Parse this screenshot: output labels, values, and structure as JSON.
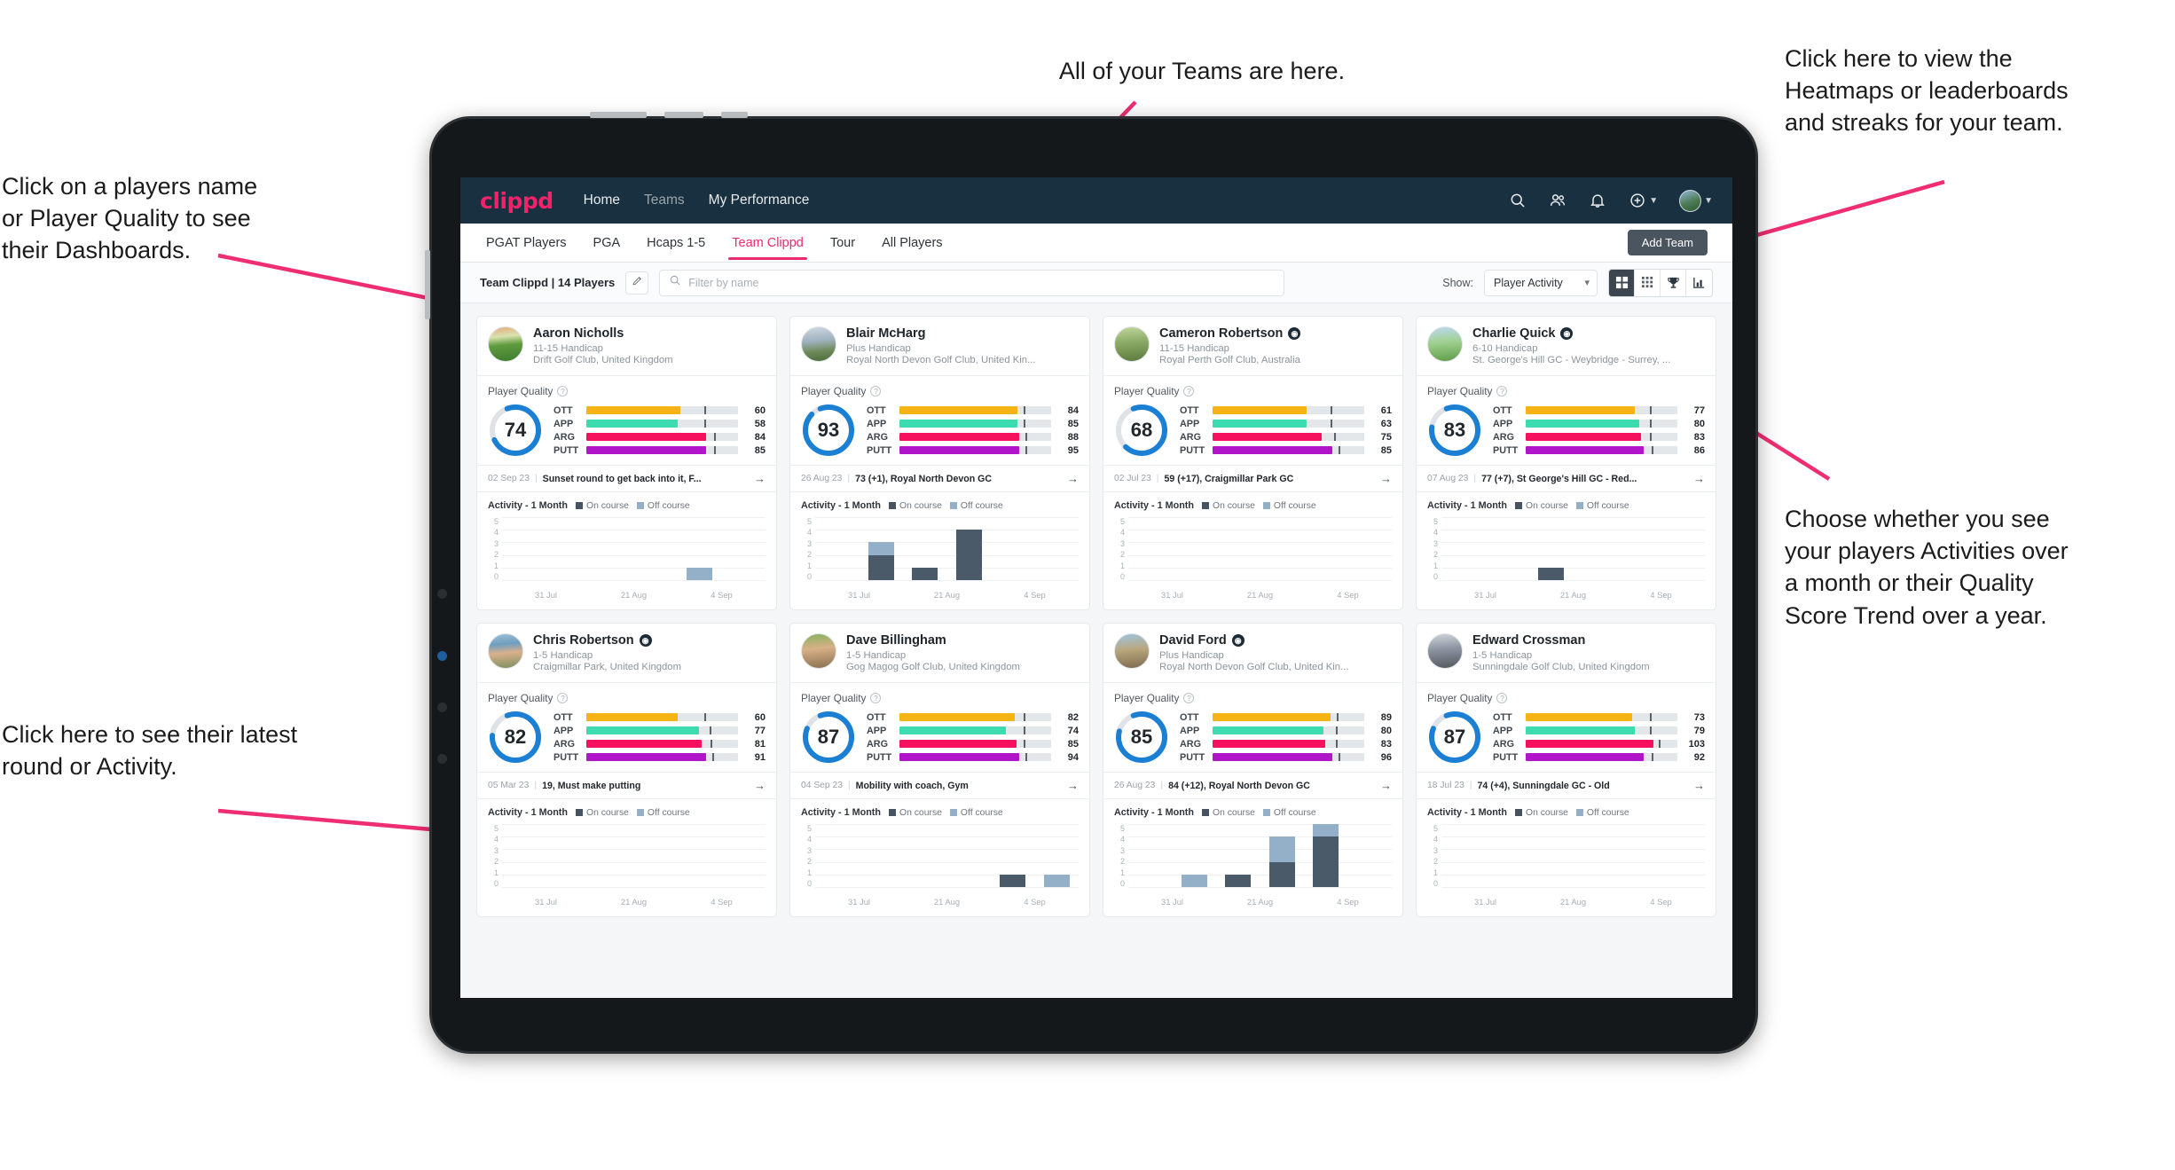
{
  "annotations": {
    "players_name": "Click on a players name\nor Player Quality to see\ntheir Dashboards.",
    "teams": "All of your Teams are here.",
    "heatmaps": "Click here to view the\nHeatmaps or leaderboards\nand streaks for your team.",
    "activities": "Choose whether you see\nyour players Activities over\na month or their Quality\nScore Trend over a year.",
    "latest_round": "Click here to see their latest\nround or Activity."
  },
  "navbar": {
    "logo": "clippd",
    "links": [
      {
        "label": "Home",
        "active": true
      },
      {
        "label": "Teams",
        "active": false
      },
      {
        "label": "My Performance",
        "active": true
      }
    ],
    "icons": [
      "search-icon",
      "people-icon",
      "bell-icon",
      "plus-circle-icon",
      "avatar"
    ]
  },
  "tabs": [
    {
      "label": "PGAT Players",
      "active": false
    },
    {
      "label": "PGA",
      "active": false
    },
    {
      "label": "Hcaps 1-5",
      "active": false
    },
    {
      "label": "Team Clippd",
      "active": true
    },
    {
      "label": "Tour",
      "active": false
    },
    {
      "label": "All Players",
      "active": false
    }
  ],
  "add_team_label": "Add Team",
  "filterbar": {
    "team_label": "Team Clippd | 14 Players",
    "edit_icon": "pencil-icon",
    "search_placeholder": "Filter by name",
    "search_value": "",
    "show_label": "Show:",
    "show_value": "Player Activity",
    "view_modes": [
      "grid-large-icon",
      "grid-small-icon",
      "trophy-icon",
      "chart-icon"
    ],
    "active_view": 0
  },
  "legend": {
    "title": "Activity - 1 Month",
    "on_course": "On course",
    "off_course": "Off course"
  },
  "quality_label": "Player Quality",
  "chart_data": {
    "type": "bar",
    "ylim": [
      0,
      5
    ],
    "yticks": [
      5,
      4,
      3,
      2,
      1,
      0
    ],
    "xticks": [
      "31 Jul",
      "21 Aug",
      "4 Sep"
    ],
    "series_names": [
      "On course",
      "Off course"
    ],
    "colors": {
      "on_course": "#4b5a68",
      "off_course": "#93b0c8"
    }
  },
  "players": [
    {
      "name": "Aaron Nicholls",
      "verified": false,
      "handicap": "11-15 Handicap",
      "club": "Drift Golf Club, United Kingdom",
      "score": 74,
      "metrics": [
        {
          "label": "OTT",
          "value": 60,
          "fill": 62,
          "tick": 78,
          "color": "#f5b414"
        },
        {
          "label": "APP",
          "value": 58,
          "fill": 60,
          "tick": 78,
          "color": "#3ddbb0"
        },
        {
          "label": "ARG",
          "value": 84,
          "fill": 79,
          "tick": 84,
          "color": "#f5115e"
        },
        {
          "label": "PUTT",
          "value": 85,
          "fill": 79,
          "tick": 84,
          "color": "#b015c9"
        }
      ],
      "round": {
        "date": "02 Sep 23",
        "text": "Sunset round to get back into it, F..."
      },
      "activity": [
        {
          "on": 0,
          "off": 0
        },
        {
          "on": 0,
          "off": 0
        },
        {
          "on": 0,
          "off": 0
        },
        {
          "on": 0,
          "off": 0
        },
        {
          "on": 0,
          "off": 1
        },
        {
          "on": 0,
          "off": 0
        }
      ]
    },
    {
      "name": "Blair McHarg",
      "verified": false,
      "handicap": "Plus Handicap",
      "club": "Royal North Devon Golf Club, United Kin...",
      "score": 93,
      "metrics": [
        {
          "label": "OTT",
          "value": 84,
          "fill": 78,
          "tick": 82,
          "color": "#f5b414"
        },
        {
          "label": "APP",
          "value": 85,
          "fill": 78,
          "tick": 82,
          "color": "#3ddbb0"
        },
        {
          "label": "ARG",
          "value": 88,
          "fill": 79,
          "tick": 83,
          "color": "#f5115e"
        },
        {
          "label": "PUTT",
          "value": 95,
          "fill": 79,
          "tick": 83,
          "color": "#b015c9"
        }
      ],
      "round": {
        "date": "26 Aug 23",
        "text": "73 (+1), Royal North Devon GC"
      },
      "activity": [
        {
          "on": 0,
          "off": 0
        },
        {
          "on": 2,
          "off": 1
        },
        {
          "on": 1,
          "off": 0
        },
        {
          "on": 4,
          "off": 0
        },
        {
          "on": 0,
          "off": 0
        },
        {
          "on": 0,
          "off": 0
        }
      ]
    },
    {
      "name": "Cameron Robertson",
      "verified": true,
      "handicap": "11-15 Handicap",
      "club": "Royal Perth Golf Club, Australia",
      "score": 68,
      "metrics": [
        {
          "label": "OTT",
          "value": 61,
          "fill": 62,
          "tick": 78,
          "color": "#f5b414"
        },
        {
          "label": "APP",
          "value": 63,
          "fill": 62,
          "tick": 78,
          "color": "#3ddbb0"
        },
        {
          "label": "ARG",
          "value": 75,
          "fill": 72,
          "tick": 80,
          "color": "#f5115e"
        },
        {
          "label": "PUTT",
          "value": 85,
          "fill": 79,
          "tick": 83,
          "color": "#b015c9"
        }
      ],
      "round": {
        "date": "02 Jul 23",
        "text": "59 (+17), Craigmillar Park GC"
      },
      "activity": [
        {
          "on": 0,
          "off": 0
        },
        {
          "on": 0,
          "off": 0
        },
        {
          "on": 0,
          "off": 0
        },
        {
          "on": 0,
          "off": 0
        },
        {
          "on": 0,
          "off": 0
        },
        {
          "on": 0,
          "off": 0
        }
      ]
    },
    {
      "name": "Charlie Quick",
      "verified": true,
      "handicap": "6-10 Handicap",
      "club": "St. George's Hill GC - Weybridge - Surrey, ...",
      "score": 83,
      "metrics": [
        {
          "label": "OTT",
          "value": 77,
          "fill": 72,
          "tick": 82,
          "color": "#f5b414"
        },
        {
          "label": "APP",
          "value": 80,
          "fill": 75,
          "tick": 82,
          "color": "#3ddbb0"
        },
        {
          "label": "ARG",
          "value": 83,
          "fill": 76,
          "tick": 82,
          "color": "#f5115e"
        },
        {
          "label": "PUTT",
          "value": 86,
          "fill": 78,
          "tick": 83,
          "color": "#b015c9"
        }
      ],
      "round": {
        "date": "07 Aug 23",
        "text": "77 (+7), St George's Hill GC - Red..."
      },
      "activity": [
        {
          "on": 0,
          "off": 0
        },
        {
          "on": 0,
          "off": 0
        },
        {
          "on": 1,
          "off": 0
        },
        {
          "on": 0,
          "off": 0
        },
        {
          "on": 0,
          "off": 0
        },
        {
          "on": 0,
          "off": 0
        }
      ]
    },
    {
      "name": "Chris Robertson",
      "verified": true,
      "handicap": "1-5 Handicap",
      "club": "Craigmillar Park, United Kingdom",
      "score": 82,
      "metrics": [
        {
          "label": "OTT",
          "value": 60,
          "fill": 60,
          "tick": 78,
          "color": "#f5b414"
        },
        {
          "label": "APP",
          "value": 77,
          "fill": 74,
          "tick": 81,
          "color": "#3ddbb0"
        },
        {
          "label": "ARG",
          "value": 81,
          "fill": 76,
          "tick": 82,
          "color": "#f5115e"
        },
        {
          "label": "PUTT",
          "value": 91,
          "fill": 79,
          "tick": 83,
          "color": "#b015c9"
        }
      ],
      "round": {
        "date": "05 Mar 23",
        "text": "19, Must make putting"
      },
      "activity": [
        {
          "on": 0,
          "off": 0
        },
        {
          "on": 0,
          "off": 0
        },
        {
          "on": 0,
          "off": 0
        },
        {
          "on": 0,
          "off": 0
        },
        {
          "on": 0,
          "off": 0
        },
        {
          "on": 0,
          "off": 0
        }
      ]
    },
    {
      "name": "Dave Billingham",
      "verified": false,
      "handicap": "1-5 Handicap",
      "club": "Gog Magog Golf Club, United Kingdom",
      "score": 87,
      "metrics": [
        {
          "label": "OTT",
          "value": 82,
          "fill": 76,
          "tick": 82,
          "color": "#f5b414"
        },
        {
          "label": "APP",
          "value": 74,
          "fill": 70,
          "tick": 82,
          "color": "#3ddbb0"
        },
        {
          "label": "ARG",
          "value": 85,
          "fill": 77,
          "tick": 82,
          "color": "#f5115e"
        },
        {
          "label": "PUTT",
          "value": 94,
          "fill": 79,
          "tick": 83,
          "color": "#b015c9"
        }
      ],
      "round": {
        "date": "04 Sep 23",
        "text": "Mobility with coach, Gym"
      },
      "activity": [
        {
          "on": 0,
          "off": 0
        },
        {
          "on": 0,
          "off": 0
        },
        {
          "on": 0,
          "off": 0
        },
        {
          "on": 0,
          "off": 0
        },
        {
          "on": 1,
          "off": 0
        },
        {
          "on": 0,
          "off": 1
        }
      ]
    },
    {
      "name": "David Ford",
      "verified": true,
      "handicap": "Plus Handicap",
      "club": "Royal North Devon Golf Club, United Kin...",
      "score": 85,
      "metrics": [
        {
          "label": "OTT",
          "value": 89,
          "fill": 78,
          "tick": 82,
          "color": "#f5b414"
        },
        {
          "label": "APP",
          "value": 80,
          "fill": 73,
          "tick": 81,
          "color": "#3ddbb0"
        },
        {
          "label": "ARG",
          "value": 83,
          "fill": 74,
          "tick": 81,
          "color": "#f5115e"
        },
        {
          "label": "PUTT",
          "value": 96,
          "fill": 79,
          "tick": 83,
          "color": "#b015c9"
        }
      ],
      "round": {
        "date": "26 Aug 23",
        "text": "84 (+12), Royal North Devon GC"
      },
      "activity": [
        {
          "on": 0,
          "off": 0
        },
        {
          "on": 0,
          "off": 1
        },
        {
          "on": 1,
          "off": 0
        },
        {
          "on": 2,
          "off": 2
        },
        {
          "on": 4,
          "off": 1
        },
        {
          "on": 0,
          "off": 0
        }
      ]
    },
    {
      "name": "Edward Crossman",
      "verified": false,
      "handicap": "1-5 Handicap",
      "club": "Sunningdale Golf Club, United Kingdom",
      "score": 87,
      "metrics": [
        {
          "label": "OTT",
          "value": 73,
          "fill": 70,
          "tick": 82,
          "color": "#f5b414"
        },
        {
          "label": "APP",
          "value": 79,
          "fill": 72,
          "tick": 82,
          "color": "#3ddbb0"
        },
        {
          "label": "ARG",
          "value": 103,
          "fill": 84,
          "tick": 88,
          "color": "#f5115e"
        },
        {
          "label": "PUTT",
          "value": 92,
          "fill": 78,
          "tick": 83,
          "color": "#b015c9"
        }
      ],
      "round": {
        "date": "18 Jul 23",
        "text": "74 (+4), Sunningdale GC - Old"
      },
      "activity": [
        {
          "on": 0,
          "off": 0
        },
        {
          "on": 0,
          "off": 0
        },
        {
          "on": 0,
          "off": 0
        },
        {
          "on": 0,
          "off": 0
        },
        {
          "on": 0,
          "off": 0
        },
        {
          "on": 0,
          "off": 0
        }
      ]
    }
  ]
}
